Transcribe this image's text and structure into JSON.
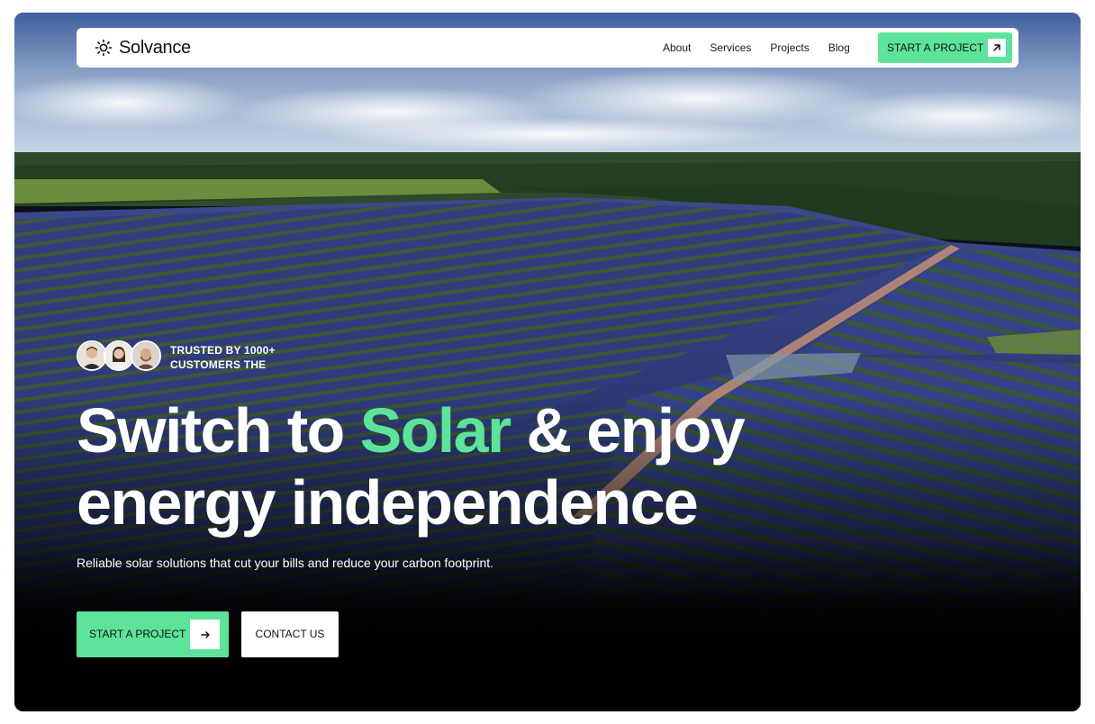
{
  "brand": {
    "name": "Solvance",
    "icon": "sun-icon"
  },
  "nav": {
    "links": [
      "About",
      "Services",
      "Projects",
      "Blog"
    ],
    "cta": {
      "label": "START A PROJECT",
      "icon": "arrow-up-right-icon"
    }
  },
  "hero": {
    "trust": {
      "line1": "TRUSTED BY 1000+",
      "line2": "CUSTOMERS THE"
    },
    "headline": {
      "before": "Switch to ",
      "highlight": "Solar",
      "after": " & enjoy",
      "line2": "energy independence"
    },
    "subtitle": "Reliable solar solutions that cut your bills and reduce your carbon footprint.",
    "primary_button": {
      "label": "START A PROJECT",
      "icon": "arrow-right-icon"
    },
    "secondary_button": {
      "label": "CONTACT US"
    }
  },
  "colors": {
    "accent": "#5de39a",
    "nav_bg": "#ffffff",
    "text_light": "#ffffff",
    "text_dark": "#111111"
  }
}
